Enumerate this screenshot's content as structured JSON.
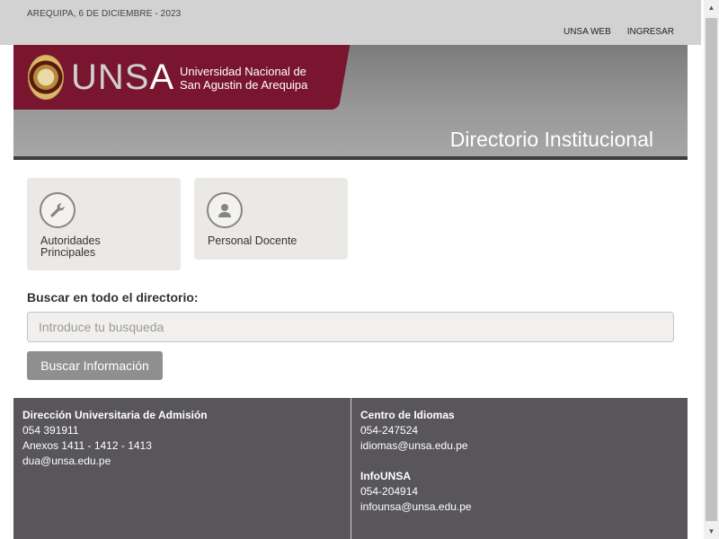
{
  "topbar": {
    "date": "AREQUIPA, 6 DE DICIEMBRE - 2023",
    "links": [
      "UNSA WEB",
      "INGRESAR"
    ]
  },
  "banner": {
    "wordmark_main": "UNS",
    "wordmark_accent": "A",
    "subtitle_line1": "Universidad Nacional de",
    "subtitle_line2": "San Agustin de Arequipa",
    "title": "Directorio Institucional",
    "brand_color": "#7a1530"
  },
  "cards": [
    {
      "label": "Autoridades Principales",
      "icon": "wrench-icon"
    },
    {
      "label": "Personal Docente",
      "icon": "person-icon"
    }
  ],
  "search": {
    "label": "Buscar en todo el directorio:",
    "placeholder": "Introduce tu busqueda",
    "value": "",
    "button_label": "Buscar Información"
  },
  "footer": {
    "left": {
      "title": "Dirección Universitaria de Admisión",
      "phone": "054 391911",
      "extensions": "Anexos 1411 - 1412 - 1413",
      "email": "dua@unsa.edu.pe"
    },
    "right": [
      {
        "title": "Centro de Idiomas",
        "phone": "054-247524",
        "email": "idiomas@unsa.edu.pe"
      },
      {
        "title": "InfoUNSA",
        "phone": "054-204914",
        "email": "infounsa@unsa.edu.pe"
      }
    ]
  }
}
